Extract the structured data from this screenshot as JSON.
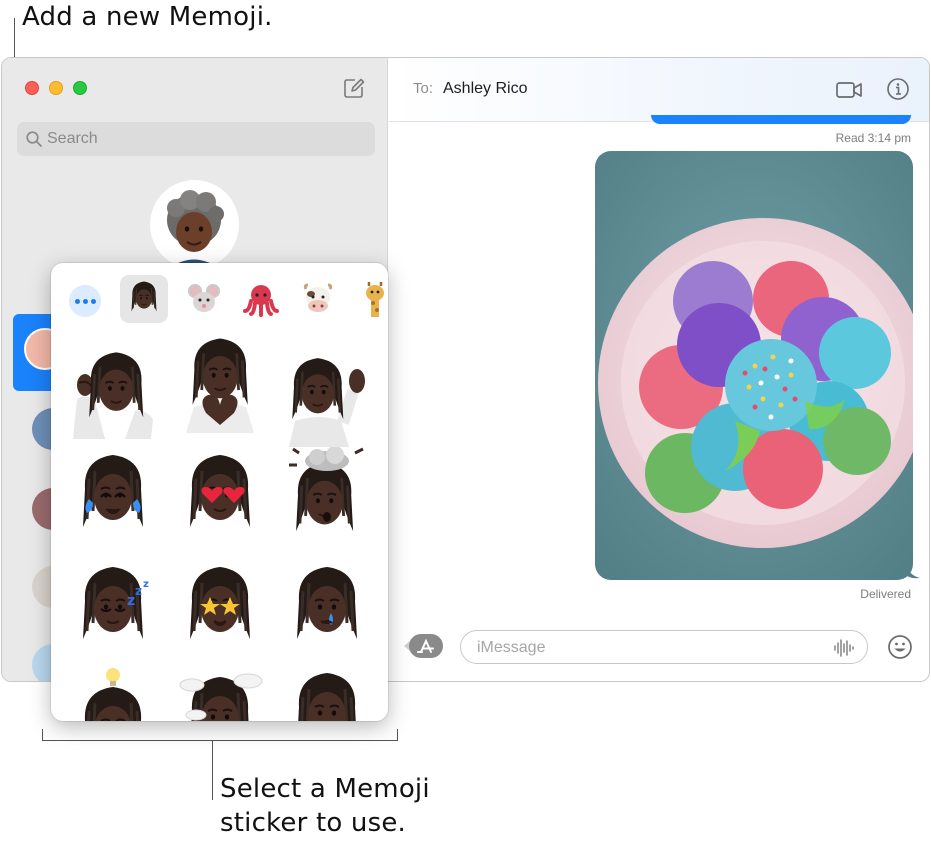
{
  "callouts": {
    "top": "Add a new Memoji.",
    "bottom_line1": "Select a Memoji",
    "bottom_line2": "sticker to use."
  },
  "window": {
    "sidebar": {
      "search_placeholder": "Search",
      "icons": [
        "compose-icon",
        "search-icon"
      ]
    },
    "header": {
      "to_label": "To:",
      "recipient": "Ashley Rico",
      "icons": [
        "video-call-icon",
        "info-icon"
      ]
    },
    "conversation": {
      "read_receipt": "Read 3:14 pm",
      "delivered": "Delivered",
      "photo_subject": "macarons"
    },
    "composer": {
      "placeholder": "iMessage",
      "icons": [
        "app-store-icon",
        "audio-waveform-icon",
        "emoji-icon"
      ]
    }
  },
  "sticker_picker": {
    "categories": [
      "more",
      "memoji",
      "mouse",
      "octopus",
      "cow",
      "giraffe"
    ],
    "stickers": [
      "call-me",
      "heart-hands",
      "wave",
      "tears-of-joy",
      "heart-eyes",
      "mind-blown",
      "sleeping",
      "star-struck",
      "crying",
      "idea",
      "head-in-clouds",
      "sneezing"
    ]
  },
  "colors": {
    "accent": "#1a82fb",
    "sidebar_bg": "#e9e9e9",
    "close": "#fe5f57",
    "minimize": "#febc2e",
    "maximize": "#28c840"
  }
}
